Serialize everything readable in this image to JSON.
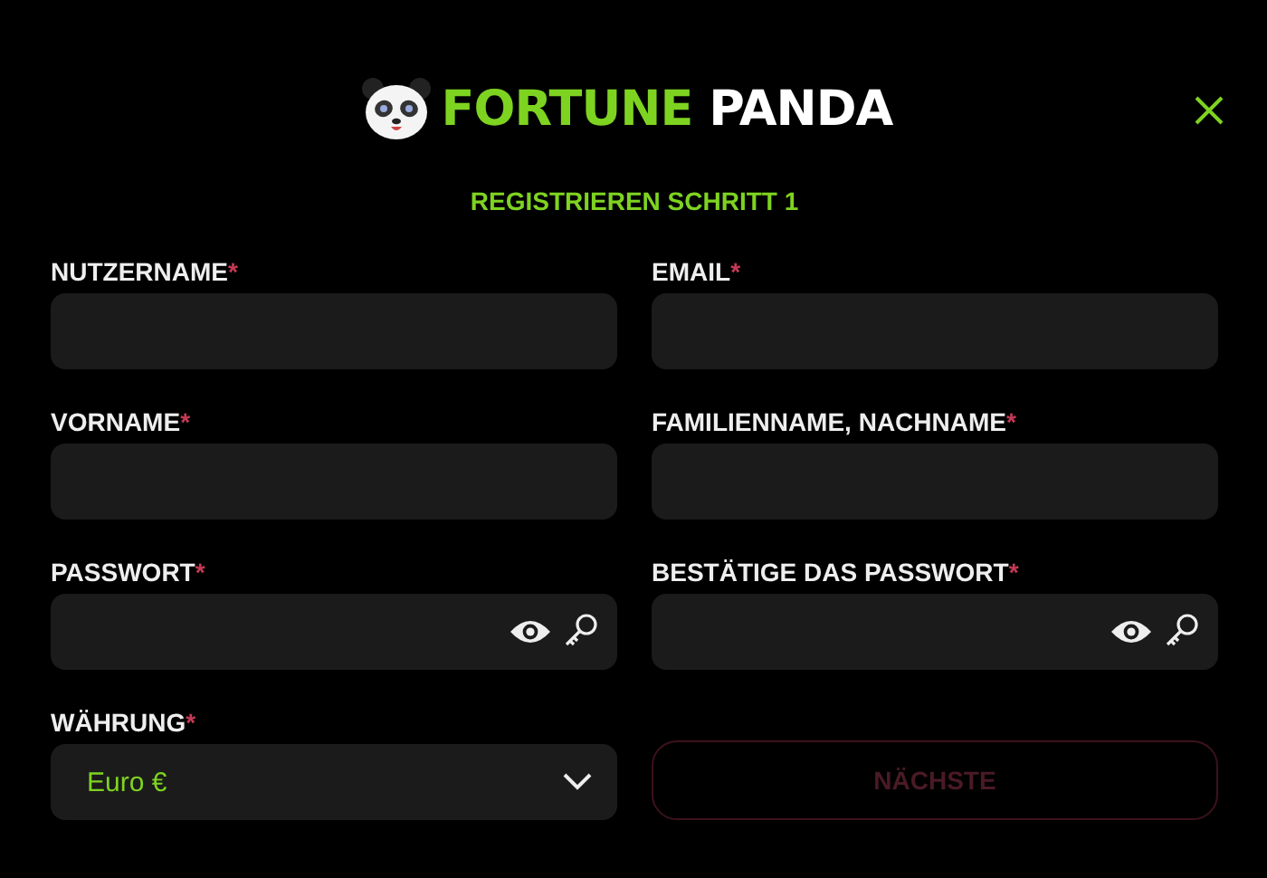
{
  "logo": {
    "words": [
      "FORTUNE",
      "PANDA"
    ]
  },
  "heading": "REGISTRIEREN SCHRITT 1",
  "fields": [
    {
      "label": "NUTZERNAME",
      "required_mark": "*",
      "kind": "text"
    },
    {
      "label": "EMAIL",
      "required_mark": "*",
      "kind": "text"
    },
    {
      "label": "VORNAME",
      "required_mark": "*",
      "kind": "text"
    },
    {
      "label": "FAMILIENNAME, NACHNAME",
      "required_mark": "*",
      "kind": "text"
    },
    {
      "label": "PASSWORT",
      "required_mark": "*",
      "kind": "password"
    },
    {
      "label": "BESTÄTIGE DAS PASSWORT",
      "required_mark": "*",
      "kind": "password"
    },
    {
      "label": "WÄHRUNG",
      "required_mark": "*",
      "kind": "select",
      "value": "Euro €"
    }
  ],
  "next_button": {
    "label": "NÄCHSTE",
    "disabled": true
  }
}
